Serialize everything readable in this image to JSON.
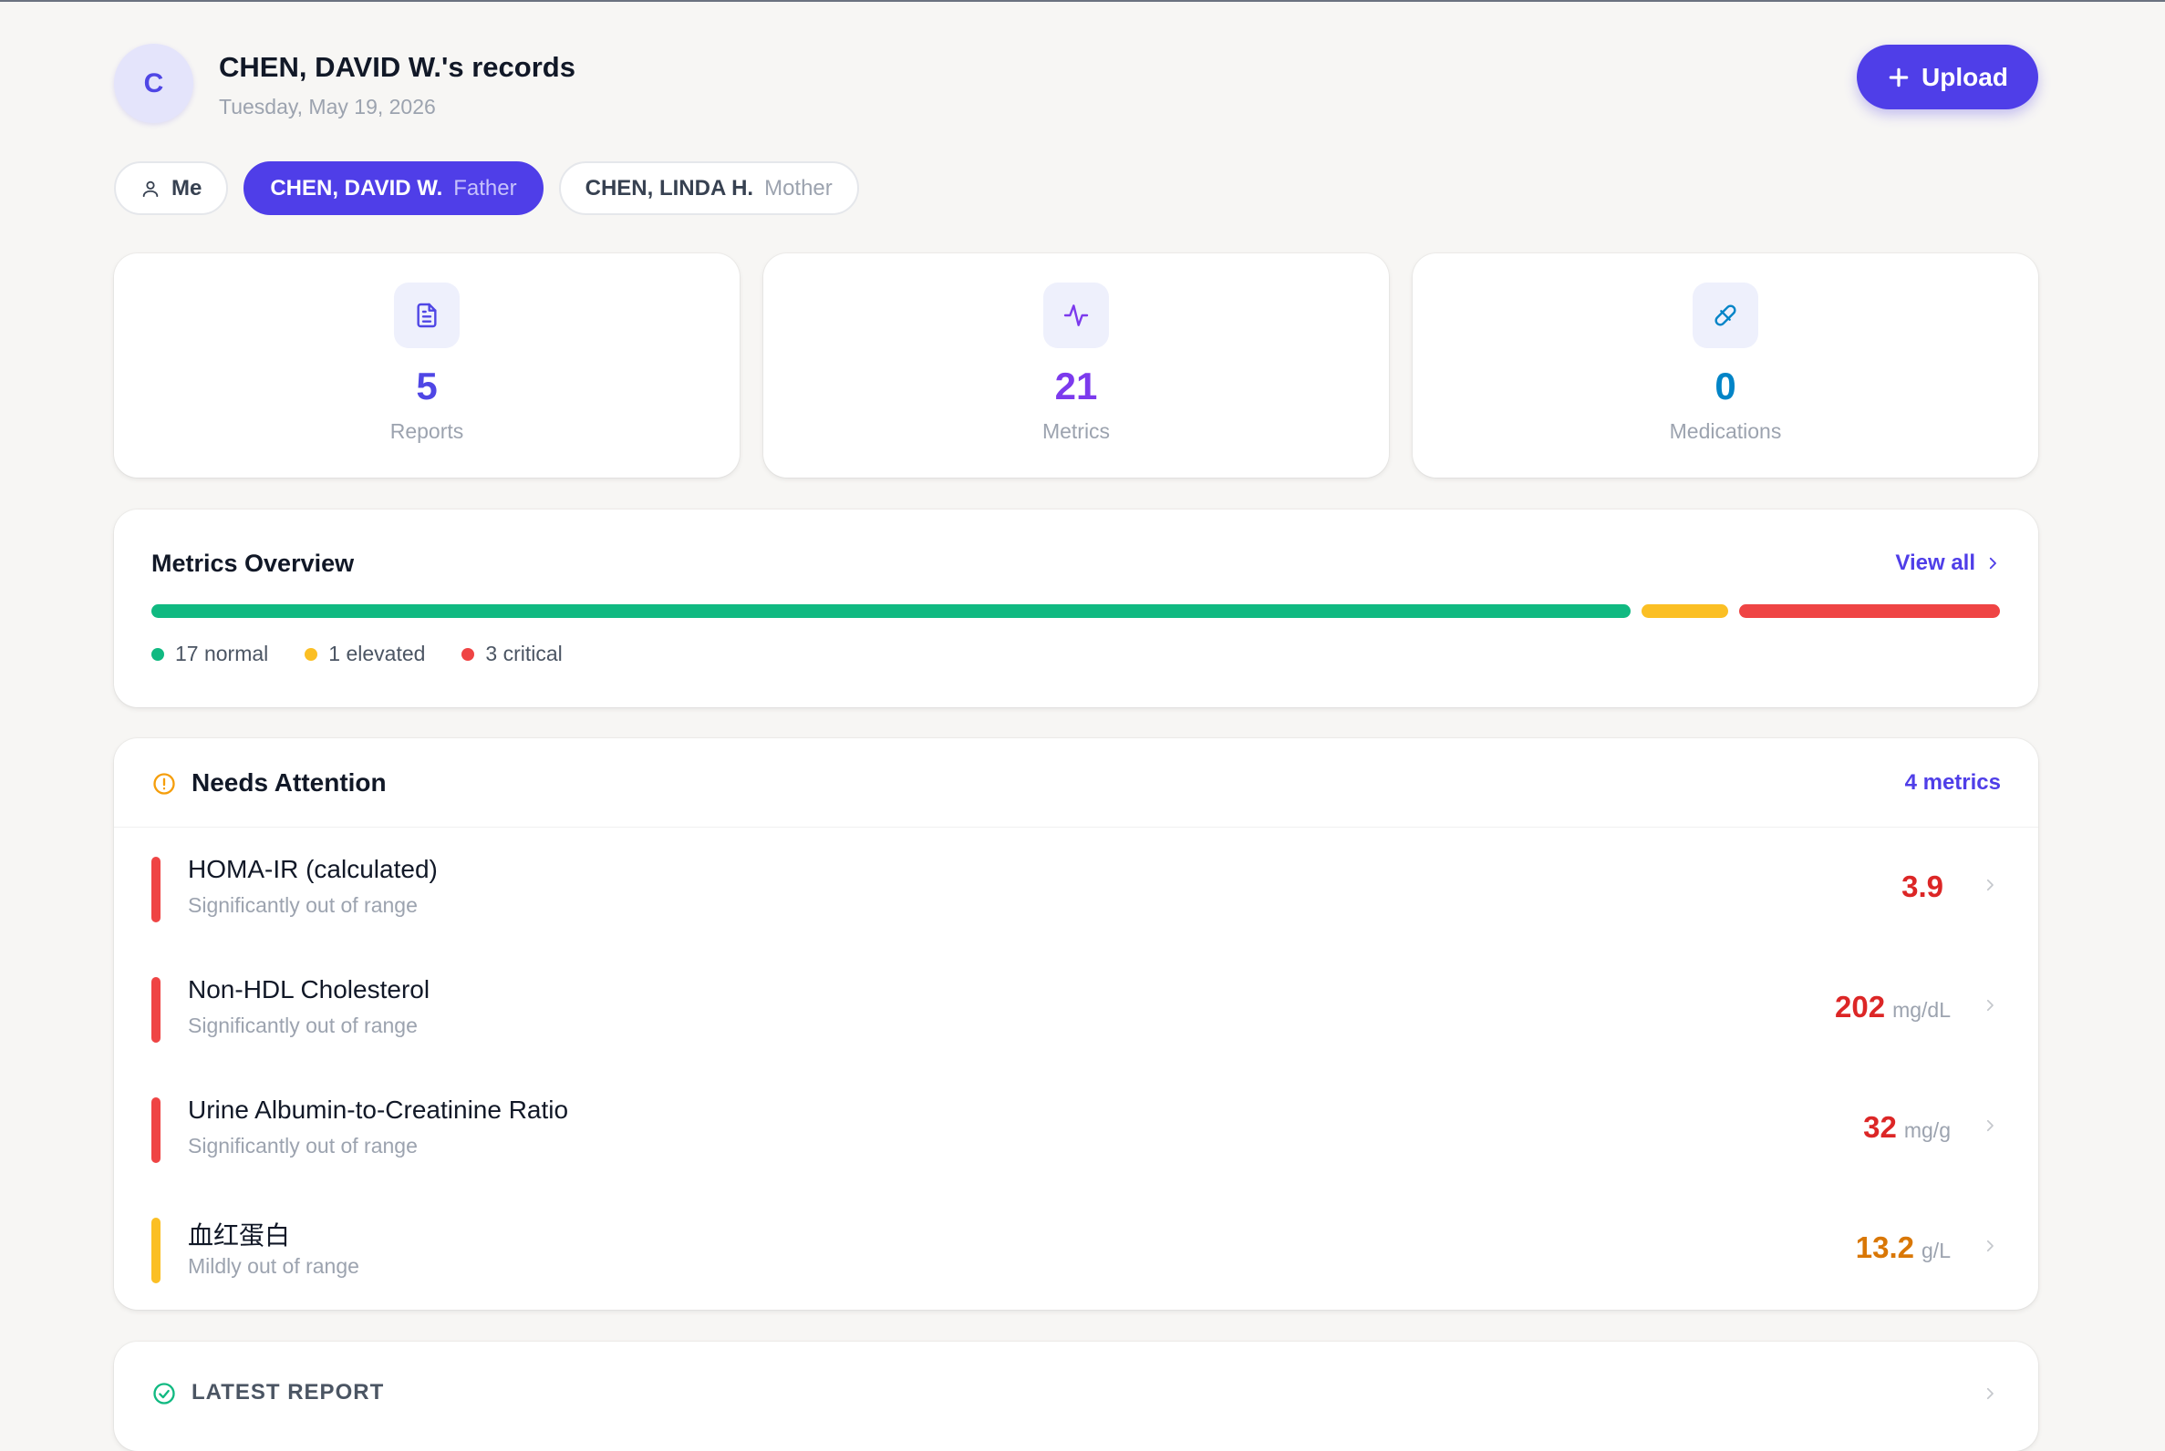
{
  "header": {
    "avatar_letter": "C",
    "title": "CHEN, DAVID W.'s records",
    "date": "Tuesday, May 19, 2026",
    "upload_label": "Upload"
  },
  "tabs": [
    {
      "name": "Me",
      "relation": "",
      "active": false,
      "icon": "user-icon"
    },
    {
      "name": "CHEN, DAVID W.",
      "relation": "Father",
      "active": true
    },
    {
      "name": "CHEN, LINDA H.",
      "relation": "Mother",
      "active": false
    }
  ],
  "stats": [
    {
      "value": "5",
      "label": "Reports",
      "icon": "document-icon",
      "color": "#4f46e5"
    },
    {
      "value": "21",
      "label": "Metrics",
      "icon": "activity-icon",
      "color": "#7c3aed"
    },
    {
      "value": "0",
      "label": "Medications",
      "icon": "pill-icon",
      "color": "#0284c7"
    }
  ],
  "overview": {
    "title": "Metrics Overview",
    "view_all": "View all",
    "counts": {
      "normal": 17,
      "elevated": 1,
      "critical": 3
    },
    "legend": {
      "normal": "17 normal",
      "elevated": "1 elevated",
      "critical": "3 critical"
    },
    "colors": {
      "normal": "#10b981",
      "elevated": "#fbbf24",
      "critical": "#ef4444"
    }
  },
  "attention": {
    "title": "Needs Attention",
    "count_label": "4 metrics",
    "items": [
      {
        "name": "HOMA-IR (calculated)",
        "status": "Significantly out of range",
        "value": "3.9",
        "unit": "",
        "level": "critical"
      },
      {
        "name": "Non-HDL Cholesterol",
        "status": "Significantly out of range",
        "value": "202",
        "unit": "mg/dL",
        "level": "critical"
      },
      {
        "name": "Urine Albumin-to-Creatinine Ratio",
        "status": "Significantly out of range",
        "value": "32",
        "unit": "mg/g",
        "level": "critical"
      },
      {
        "name": "血红蛋白",
        "status": "Mildly out of range",
        "value": "13.2",
        "unit": "g/L",
        "level": "elevated"
      }
    ],
    "level_colors": {
      "critical": {
        "bar": "#ef4444",
        "text": "#dc2626"
      },
      "elevated": {
        "bar": "#fbbf24",
        "text": "#d97706"
      }
    }
  },
  "latest": {
    "title": "LATEST REPORT"
  }
}
